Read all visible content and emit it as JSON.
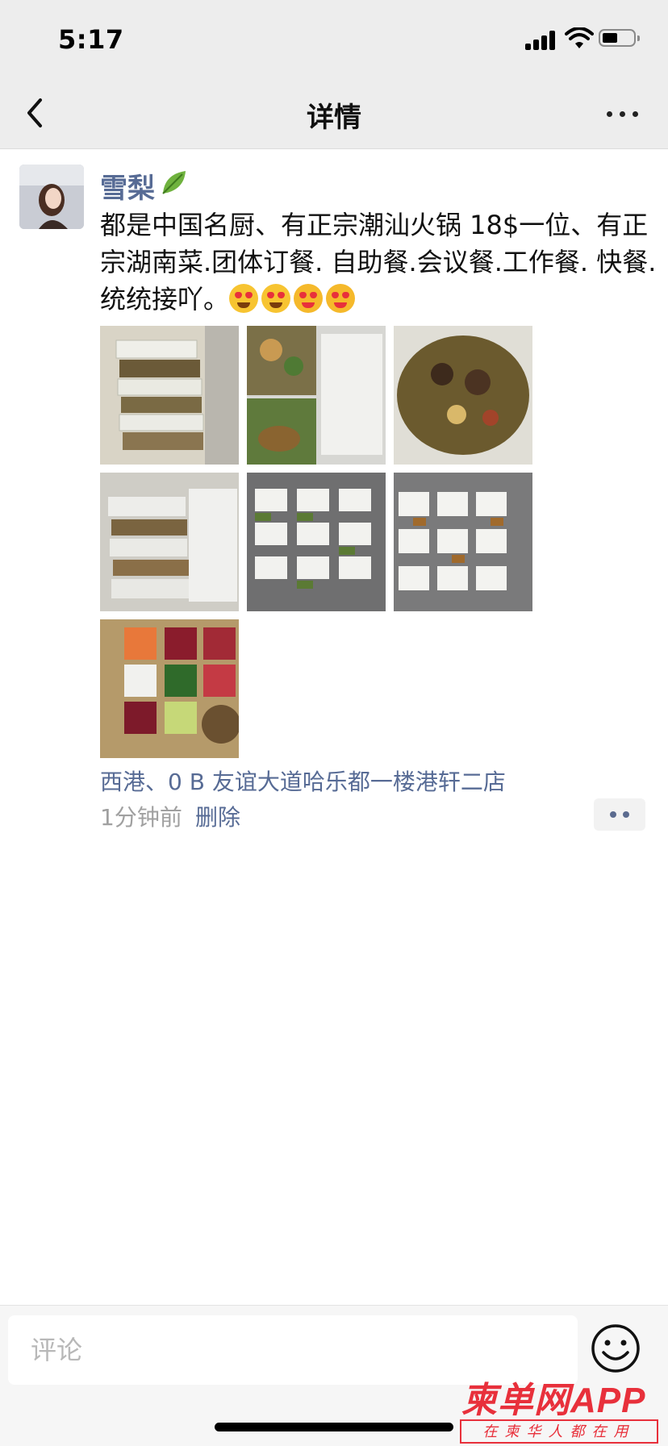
{
  "status_bar": {
    "time": "5:17"
  },
  "nav": {
    "title": "详情"
  },
  "post": {
    "username": "雪梨",
    "text": "都是中国名厨、有正宗潮汕火锅 18$一位、有正宗湖南菜.团体订餐. 自助餐.会议餐.工作餐. 快餐. 统统接吖。",
    "location": "西港、0 B 友谊大道哈乐都一楼港轩二店",
    "time_ago": "1分钟前",
    "delete_label": "删除"
  },
  "comment_bar": {
    "placeholder": "评论"
  },
  "watermark": {
    "main": "柬单网APP",
    "sub": "在柬华人都在用"
  }
}
